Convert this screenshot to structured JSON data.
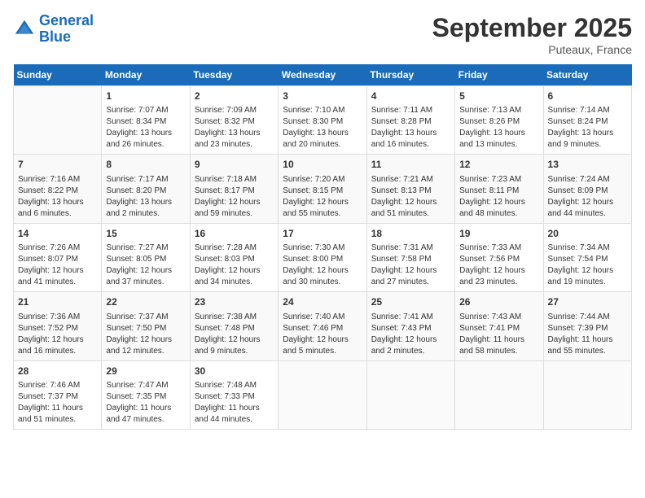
{
  "header": {
    "logo_line1": "General",
    "logo_line2": "Blue",
    "month": "September 2025",
    "location": "Puteaux, France"
  },
  "days_of_week": [
    "Sunday",
    "Monday",
    "Tuesday",
    "Wednesday",
    "Thursday",
    "Friday",
    "Saturday"
  ],
  "weeks": [
    [
      {
        "num": "",
        "info": ""
      },
      {
        "num": "1",
        "info": "Sunrise: 7:07 AM\nSunset: 8:34 PM\nDaylight: 13 hours\nand 26 minutes."
      },
      {
        "num": "2",
        "info": "Sunrise: 7:09 AM\nSunset: 8:32 PM\nDaylight: 13 hours\nand 23 minutes."
      },
      {
        "num": "3",
        "info": "Sunrise: 7:10 AM\nSunset: 8:30 PM\nDaylight: 13 hours\nand 20 minutes."
      },
      {
        "num": "4",
        "info": "Sunrise: 7:11 AM\nSunset: 8:28 PM\nDaylight: 13 hours\nand 16 minutes."
      },
      {
        "num": "5",
        "info": "Sunrise: 7:13 AM\nSunset: 8:26 PM\nDaylight: 13 hours\nand 13 minutes."
      },
      {
        "num": "6",
        "info": "Sunrise: 7:14 AM\nSunset: 8:24 PM\nDaylight: 13 hours\nand 9 minutes."
      }
    ],
    [
      {
        "num": "7",
        "info": "Sunrise: 7:16 AM\nSunset: 8:22 PM\nDaylight: 13 hours\nand 6 minutes."
      },
      {
        "num": "8",
        "info": "Sunrise: 7:17 AM\nSunset: 8:20 PM\nDaylight: 13 hours\nand 2 minutes."
      },
      {
        "num": "9",
        "info": "Sunrise: 7:18 AM\nSunset: 8:17 PM\nDaylight: 12 hours\nand 59 minutes."
      },
      {
        "num": "10",
        "info": "Sunrise: 7:20 AM\nSunset: 8:15 PM\nDaylight: 12 hours\nand 55 minutes."
      },
      {
        "num": "11",
        "info": "Sunrise: 7:21 AM\nSunset: 8:13 PM\nDaylight: 12 hours\nand 51 minutes."
      },
      {
        "num": "12",
        "info": "Sunrise: 7:23 AM\nSunset: 8:11 PM\nDaylight: 12 hours\nand 48 minutes."
      },
      {
        "num": "13",
        "info": "Sunrise: 7:24 AM\nSunset: 8:09 PM\nDaylight: 12 hours\nand 44 minutes."
      }
    ],
    [
      {
        "num": "14",
        "info": "Sunrise: 7:26 AM\nSunset: 8:07 PM\nDaylight: 12 hours\nand 41 minutes."
      },
      {
        "num": "15",
        "info": "Sunrise: 7:27 AM\nSunset: 8:05 PM\nDaylight: 12 hours\nand 37 minutes."
      },
      {
        "num": "16",
        "info": "Sunrise: 7:28 AM\nSunset: 8:03 PM\nDaylight: 12 hours\nand 34 minutes."
      },
      {
        "num": "17",
        "info": "Sunrise: 7:30 AM\nSunset: 8:00 PM\nDaylight: 12 hours\nand 30 minutes."
      },
      {
        "num": "18",
        "info": "Sunrise: 7:31 AM\nSunset: 7:58 PM\nDaylight: 12 hours\nand 27 minutes."
      },
      {
        "num": "19",
        "info": "Sunrise: 7:33 AM\nSunset: 7:56 PM\nDaylight: 12 hours\nand 23 minutes."
      },
      {
        "num": "20",
        "info": "Sunrise: 7:34 AM\nSunset: 7:54 PM\nDaylight: 12 hours\nand 19 minutes."
      }
    ],
    [
      {
        "num": "21",
        "info": "Sunrise: 7:36 AM\nSunset: 7:52 PM\nDaylight: 12 hours\nand 16 minutes."
      },
      {
        "num": "22",
        "info": "Sunrise: 7:37 AM\nSunset: 7:50 PM\nDaylight: 12 hours\nand 12 minutes."
      },
      {
        "num": "23",
        "info": "Sunrise: 7:38 AM\nSunset: 7:48 PM\nDaylight: 12 hours\nand 9 minutes."
      },
      {
        "num": "24",
        "info": "Sunrise: 7:40 AM\nSunset: 7:46 PM\nDaylight: 12 hours\nand 5 minutes."
      },
      {
        "num": "25",
        "info": "Sunrise: 7:41 AM\nSunset: 7:43 PM\nDaylight: 12 hours\nand 2 minutes."
      },
      {
        "num": "26",
        "info": "Sunrise: 7:43 AM\nSunset: 7:41 PM\nDaylight: 11 hours\nand 58 minutes."
      },
      {
        "num": "27",
        "info": "Sunrise: 7:44 AM\nSunset: 7:39 PM\nDaylight: 11 hours\nand 55 minutes."
      }
    ],
    [
      {
        "num": "28",
        "info": "Sunrise: 7:46 AM\nSunset: 7:37 PM\nDaylight: 11 hours\nand 51 minutes."
      },
      {
        "num": "29",
        "info": "Sunrise: 7:47 AM\nSunset: 7:35 PM\nDaylight: 11 hours\nand 47 minutes."
      },
      {
        "num": "30",
        "info": "Sunrise: 7:48 AM\nSunset: 7:33 PM\nDaylight: 11 hours\nand 44 minutes."
      },
      {
        "num": "",
        "info": ""
      },
      {
        "num": "",
        "info": ""
      },
      {
        "num": "",
        "info": ""
      },
      {
        "num": "",
        "info": ""
      }
    ]
  ]
}
